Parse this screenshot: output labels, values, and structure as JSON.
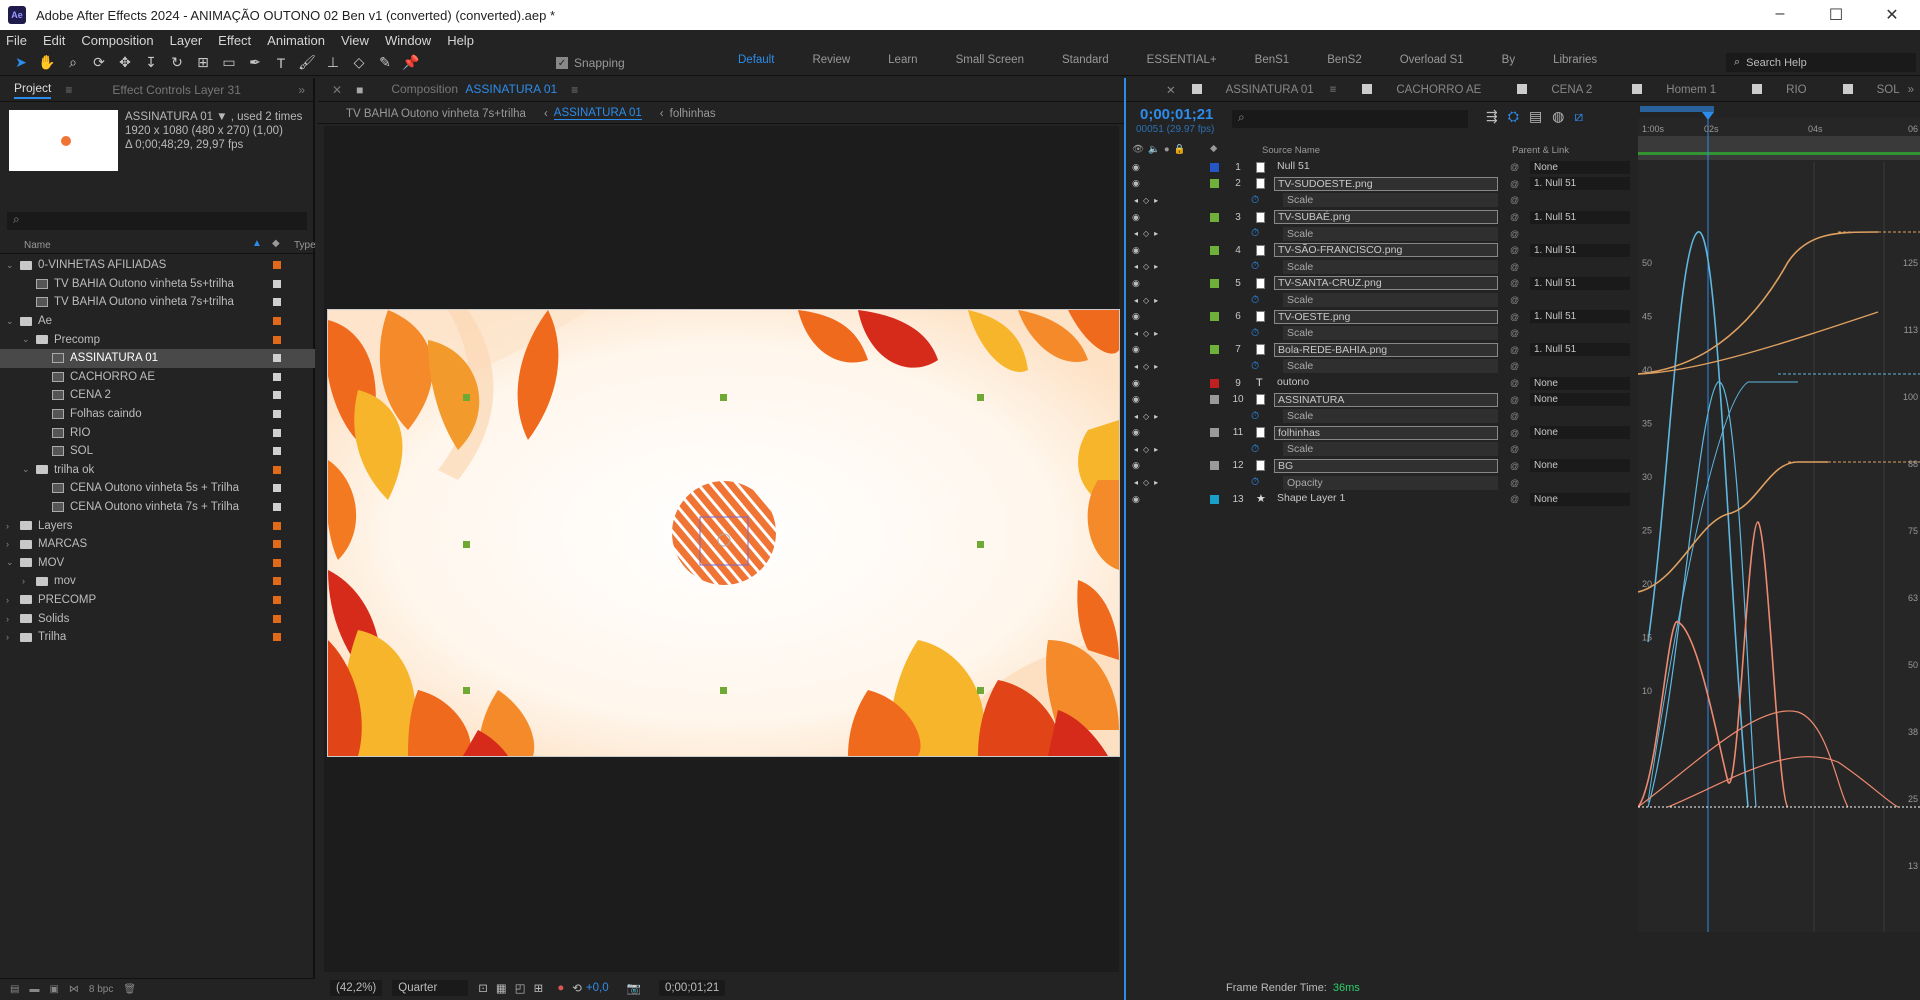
{
  "titlebar": {
    "app_logo": "Ae",
    "title": "Adobe After Effects 2024 - ANIMAÇÃO OUTONO 02 Ben v1 (converted) (converted).aep *"
  },
  "menu": [
    "File",
    "Edit",
    "Composition",
    "Layer",
    "Effect",
    "Animation",
    "View",
    "Window",
    "Help"
  ],
  "toolbar": {
    "snapping_label": "Snapping",
    "workspaces": [
      "Default",
      "Review",
      "Learn",
      "Small Screen",
      "Standard",
      "ESSENTIAL+",
      "BenS1",
      "BenS2",
      "Overload S1",
      "By",
      "Libraries"
    ],
    "active_workspace": "Default",
    "search_help": "Search Help"
  },
  "project": {
    "tab_project": "Project",
    "tab_effect_controls": "Effect Controls Layer 31",
    "selected_name": "ASSINATURA 01 ▼ , used 2 times",
    "info_line1": "1920 x 1080  (480 x 270) (1,00)",
    "info_line2": "Δ 0;00;48;29, 29,97 fps",
    "col_name": "Name",
    "col_type": "Type",
    "items": [
      {
        "label": "0-VINHETAS AFILIADAS",
        "kind": "folder",
        "level": 0,
        "open": true
      },
      {
        "label": "TV BAHIA Outono vinheta 5s+trilha",
        "kind": "comp",
        "level": 1
      },
      {
        "label": "TV BAHIA Outono vinheta 7s+trilha",
        "kind": "comp",
        "level": 1
      },
      {
        "label": "Ae",
        "kind": "folder",
        "level": 0,
        "open": true
      },
      {
        "label": "Precomp",
        "kind": "folder",
        "level": 1,
        "open": true
      },
      {
        "label": "ASSINATURA 01",
        "kind": "comp",
        "level": 2,
        "selected": true
      },
      {
        "label": "CACHORRO AE",
        "kind": "comp",
        "level": 2
      },
      {
        "label": "CENA 2",
        "kind": "comp",
        "level": 2
      },
      {
        "label": "Folhas caindo",
        "kind": "comp",
        "level": 2
      },
      {
        "label": "RIO",
        "kind": "comp",
        "level": 2
      },
      {
        "label": "SOL",
        "kind": "comp",
        "level": 2
      },
      {
        "label": "trilha ok",
        "kind": "folder",
        "level": 1,
        "open": true
      },
      {
        "label": "CENA Outono vinheta 5s + Trilha",
        "kind": "comp",
        "level": 2
      },
      {
        "label": "CENA Outono vinheta 7s + Trilha",
        "kind": "comp",
        "level": 2
      },
      {
        "label": "Layers",
        "kind": "folder",
        "level": 0
      },
      {
        "label": "MARCAS",
        "kind": "folder",
        "level": 0
      },
      {
        "label": "MOV",
        "kind": "folder",
        "level": 0,
        "open": true
      },
      {
        "label": "mov",
        "kind": "folder",
        "level": 1
      },
      {
        "label": "PRECOMP",
        "kind": "folder",
        "level": 0
      },
      {
        "label": "Solids",
        "kind": "folder",
        "level": 0
      },
      {
        "label": "Trilha",
        "kind": "folder",
        "level": 0
      }
    ],
    "bpc": "8 bpc"
  },
  "composition": {
    "tab_label": "Composition",
    "tab_name": "ASSINATURA 01",
    "breadcrumbs": [
      "TV BAHIA Outono vinheta 7s+trilha",
      "ASSINATURA 01",
      "folhinhas"
    ],
    "zoom": "(42,2%)",
    "resolution": "Quarter",
    "exposure": "+0,0",
    "timecode": "0;00;01;21"
  },
  "timeline": {
    "tabs": [
      "ASSINATURA 01",
      "CACHORRO AE",
      "CENA 2",
      "Homem 1",
      "RIO",
      "SOL"
    ],
    "timecode": "0;00;01;21",
    "timecode_sub": "00051 (29.97 fps)",
    "col_source": "Source Name",
    "col_parent": "Parent & Link",
    "rows": [
      {
        "type": "layer",
        "num": "1",
        "name": "Null 51",
        "color": "#2456c8",
        "parent": "None",
        "boxed": false
      },
      {
        "type": "layer",
        "num": "2",
        "name": "TV-SUDOESTE.png",
        "color": "#6fb03a",
        "parent": "1. Null 51",
        "boxed": true
      },
      {
        "type": "prop",
        "name": "Scale"
      },
      {
        "type": "layer",
        "num": "3",
        "name": "TV-SUBAÉ.png",
        "color": "#6fb03a",
        "parent": "1. Null 51",
        "boxed": true
      },
      {
        "type": "prop",
        "name": "Scale"
      },
      {
        "type": "layer",
        "num": "4",
        "name": "TV-SÃO-FRANCISCO.png",
        "color": "#6fb03a",
        "parent": "1. Null 51",
        "boxed": true
      },
      {
        "type": "prop",
        "name": "Scale"
      },
      {
        "type": "layer",
        "num": "5",
        "name": "TV-SANTA-CRUZ.png",
        "color": "#6fb03a",
        "parent": "1. Null 51",
        "boxed": true
      },
      {
        "type": "prop",
        "name": "Scale"
      },
      {
        "type": "layer",
        "num": "6",
        "name": "TV-OESTE.png",
        "color": "#6fb03a",
        "parent": "1. Null 51",
        "boxed": true
      },
      {
        "type": "prop",
        "name": "Scale"
      },
      {
        "type": "layer",
        "num": "7",
        "name": "Bola-REDE-BAHIA.png",
        "color": "#6fb03a",
        "parent": "1. Null 51",
        "boxed": true
      },
      {
        "type": "prop",
        "name": "Scale"
      },
      {
        "type": "layer",
        "num": "9",
        "name": "outono",
        "color": "#c02020",
        "parent": "None",
        "boxed": false,
        "text": true
      },
      {
        "type": "layer",
        "num": "10",
        "name": "ASSINATURA",
        "color": "#9a9a9a",
        "parent": "None",
        "boxed": true
      },
      {
        "type": "prop",
        "name": "Scale"
      },
      {
        "type": "layer",
        "num": "11",
        "name": "folhinhas",
        "color": "#9a9a9a",
        "parent": "None",
        "boxed": true
      },
      {
        "type": "prop",
        "name": "Scale"
      },
      {
        "type": "layer",
        "num": "12",
        "name": "BG",
        "color": "#9a9a9a",
        "parent": "None",
        "boxed": true
      },
      {
        "type": "prop",
        "name": "Opacity"
      },
      {
        "type": "layer",
        "num": "13",
        "name": "Shape Layer 1",
        "color": "#18a0c8",
        "parent": "None",
        "boxed": false,
        "shape": true
      }
    ],
    "ruler": [
      "1:00s",
      "02s",
      "04s",
      "06"
    ],
    "graph_left_labels": [
      "50",
      "45",
      "40",
      "35",
      "30",
      "25",
      "20",
      "15",
      "10"
    ],
    "graph_right_labels": [
      "125",
      "113",
      "100",
      "88",
      "75",
      "63",
      "50",
      "38",
      "25",
      "13"
    ],
    "frame_render_label": "Frame Render Time:",
    "frame_render_value": "36ms"
  },
  "colors": {
    "accent": "#2d8ceb",
    "panel": "#232323",
    "leaf_orange": "#f07535"
  }
}
